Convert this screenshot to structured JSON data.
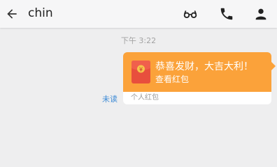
{
  "header": {
    "contact_name": "chin",
    "icons": [
      "back-arrow-icon",
      "glasses-icon",
      "phone-icon",
      "person-icon"
    ]
  },
  "chat": {
    "timestamp": "下午 3:22",
    "unread_label": "未读",
    "red_packet": {
      "greeting": "恭喜发财，大吉大利！",
      "action_label": "查看红包",
      "footer_label": "个人红包",
      "currency_symbol": "¥",
      "bubble_color": "#fba23a",
      "envelope_color": "#e84f3d"
    }
  },
  "colors": {
    "background": "#eeeeef",
    "topbar": "#f6f6f7",
    "unread_text": "#3d8bd6"
  }
}
